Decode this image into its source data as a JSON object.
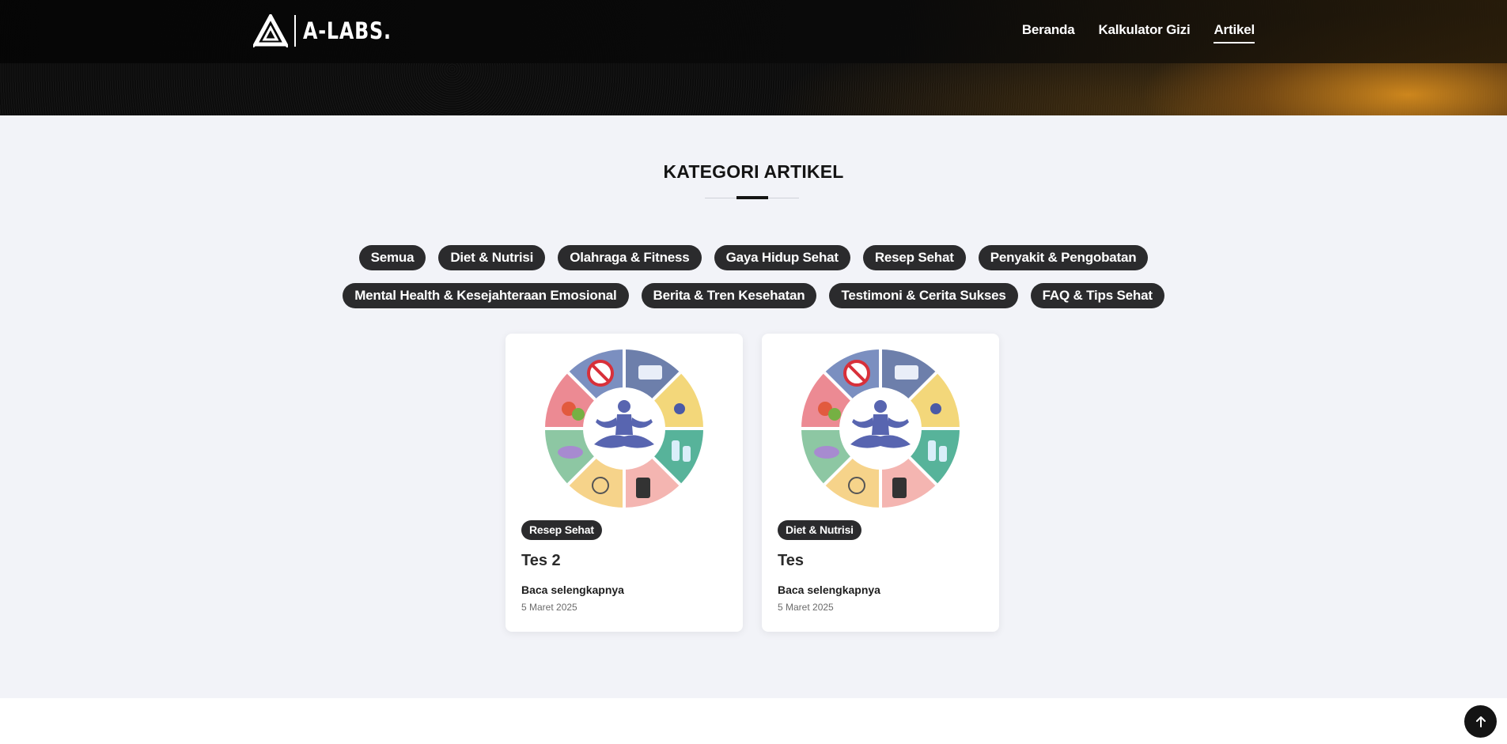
{
  "brand": {
    "name": "A-LABS."
  },
  "nav": {
    "items": [
      {
        "label": "Beranda"
      },
      {
        "label": "Kalkulator Gizi"
      },
      {
        "label": "Artikel",
        "active": true
      }
    ]
  },
  "section": {
    "title": "KATEGORI ARTIKEL"
  },
  "categories": {
    "row1": [
      "Semua",
      "Diet & Nutrisi",
      "Olahraga & Fitness",
      "Gaya Hidup Sehat",
      "Resep Sehat",
      "Penyakit & Pengobatan"
    ],
    "row2": [
      "Mental Health & Kesejahteraan Emosional",
      "Berita & Tren Kesehatan",
      "Testimoni & Cerita Sukses",
      "FAQ & Tips Sehat"
    ]
  },
  "articles": [
    {
      "category": "Resep Sehat",
      "title": "Tes 2",
      "link": "Baca selengkapnya",
      "date": "5 Maret 2025",
      "image_icon": "healthy-lifestyle-wheel-illustration"
    },
    {
      "category": "Diet & Nutrisi",
      "title": "Tes",
      "link": "Baca selengkapnya",
      "date": "5 Maret 2025",
      "image_icon": "healthy-lifestyle-wheel-illustration"
    }
  ],
  "colors": {
    "pill_bg": "#2b2b2d",
    "page_bg": "#f2f3f8",
    "accent_orange": "#d68c1e",
    "meditation_figure": "#5865b0"
  },
  "icons": {
    "back_to_top": "arrow-up-icon",
    "logo": "triangle-logo-icon"
  }
}
